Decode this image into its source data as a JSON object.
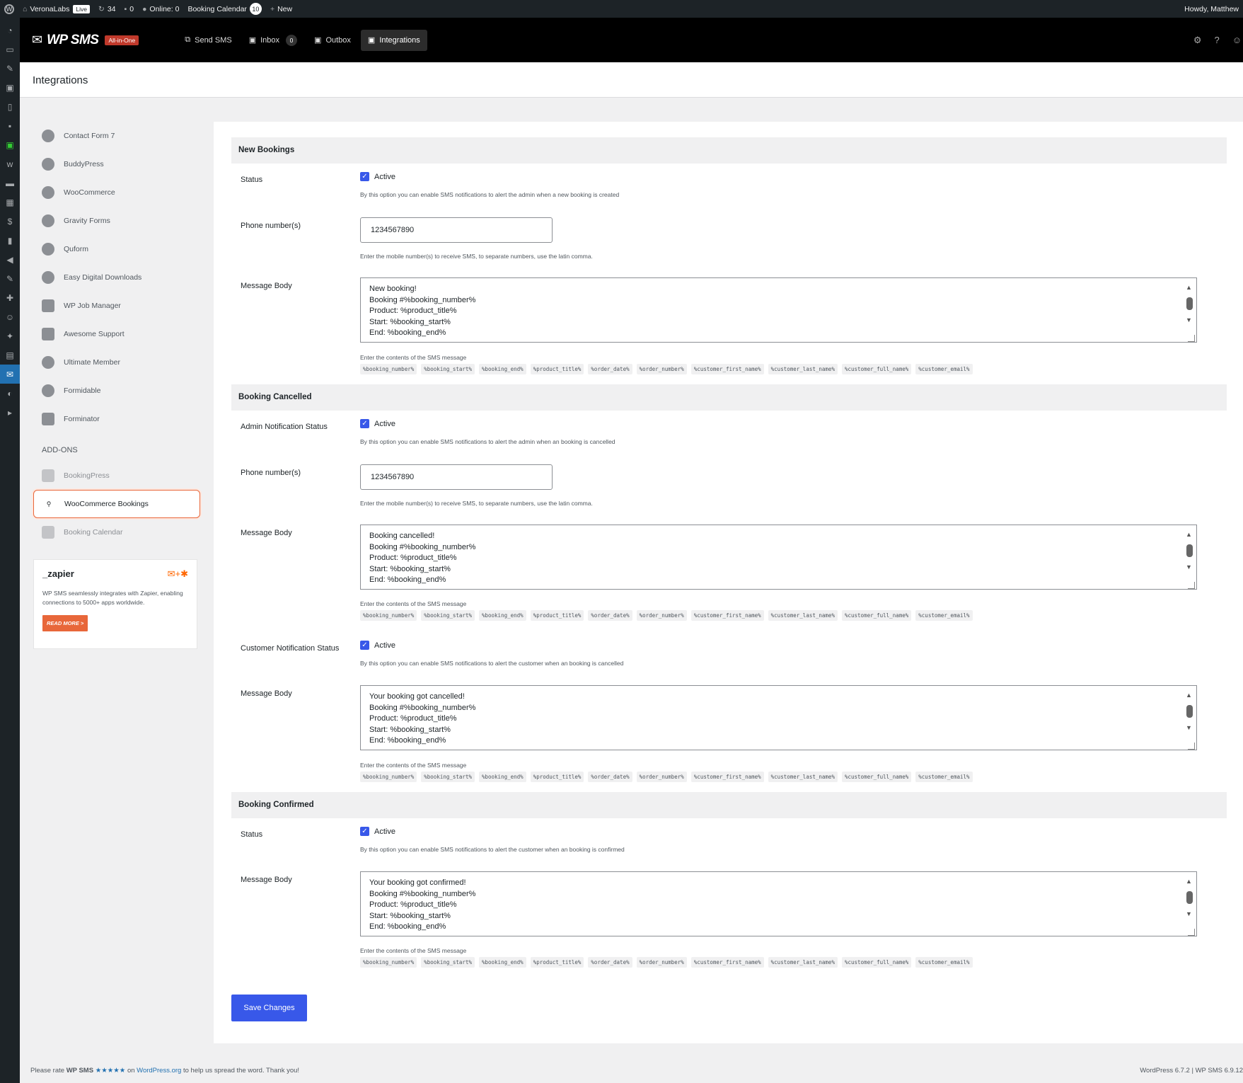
{
  "adminbar": {
    "site": "VeronaLabs",
    "live": "Live",
    "updates": "34",
    "comments": "0",
    "online": "Online: 0",
    "booking_calendar": "Booking Calendar",
    "booking_count": "10",
    "new": "New",
    "howdy": "Howdy, Matthew"
  },
  "plugin": {
    "brand": "WP SMS",
    "badge": "All-in-One",
    "tabs": [
      {
        "label": "Send SMS"
      },
      {
        "label": "Inbox",
        "count": "0"
      },
      {
        "label": "Outbox"
      },
      {
        "label": "Integrations"
      }
    ]
  },
  "page_title": "Integrations",
  "sidebar": {
    "items": [
      "Contact Form 7",
      "BuddyPress",
      "WooCommerce",
      "Gravity Forms",
      "Quform",
      "Easy Digital Downloads",
      "WP Job Manager",
      "Awesome Support",
      "Ultimate Member",
      "Formidable",
      "Forminator"
    ],
    "addons_heading": "ADD-ONS",
    "addons": [
      "BookingPress",
      "WooCommerce Bookings",
      "Booking Calendar"
    ]
  },
  "zapier": {
    "logo": "_zapier",
    "text": "WP SMS seamlessly integrates with Zapier, enabling connections to 5000+ apps worldwide.",
    "button": "READ MORE >"
  },
  "common": {
    "active": "Active",
    "phone_label": "Phone number(s)",
    "phone_help": "Enter the mobile number(s) to receive SMS, to separate numbers, use the latin comma.",
    "message_label": "Message Body",
    "message_help": "Enter the contents of the SMS message",
    "variables": [
      "%booking_number%",
      "%booking_start%",
      "%booking_end%",
      "%product_title%",
      "%order_date%",
      "%order_number%",
      "%customer_first_name%",
      "%customer_last_name%",
      "%customer_full_name%",
      "%customer_email%"
    ]
  },
  "sections": {
    "new_bookings": {
      "title": "New Bookings",
      "status_label": "Status",
      "status_desc": "By this option you can enable SMS notifications to alert the admin when a new booking is created",
      "phone": "1234567890",
      "message": [
        "New booking!",
        "Booking #%booking_number%",
        "Product: %product_title%",
        "Start: %booking_start%",
        "End: %booking_end%"
      ]
    },
    "booking_cancelled": {
      "title": "Booking Cancelled",
      "admin_status_label": "Admin Notification Status",
      "admin_status_desc": "By this option you can enable SMS notifications to alert the admin when an booking is cancelled",
      "phone": "1234567890",
      "admin_message": [
        "Booking cancelled!",
        "Booking #%booking_number%",
        "Product: %product_title%",
        "Start: %booking_start%",
        "End: %booking_end%"
      ],
      "customer_status_label": "Customer Notification Status",
      "customer_status_desc": "By this option you can enable SMS notifications to alert the customer when an booking is cancelled",
      "customer_message": [
        "Your booking got cancelled!",
        "Booking #%booking_number%",
        "Product: %product_title%",
        "Start: %booking_start%",
        "End: %booking_end%"
      ]
    },
    "booking_confirmed": {
      "title": "Booking Confirmed",
      "status_label": "Status",
      "status_desc": "By this option you can enable SMS notifications to alert the customer when an booking is confirmed",
      "message": [
        "Your booking got confirmed!",
        "Booking #%booking_number%",
        "Product: %product_title%",
        "Start: %booking_start%",
        "End: %booking_end%"
      ]
    }
  },
  "save_button": "Save Changes",
  "footer": {
    "text_before": "Please rate",
    "plugin": "WP SMS",
    "stars": "★★★★★",
    "on": "on",
    "link": "WordPress.org",
    "text_after": "to help us spread the word. Thank you!",
    "version": "WordPress 6.7.2 | WP SMS 6.9.12"
  }
}
